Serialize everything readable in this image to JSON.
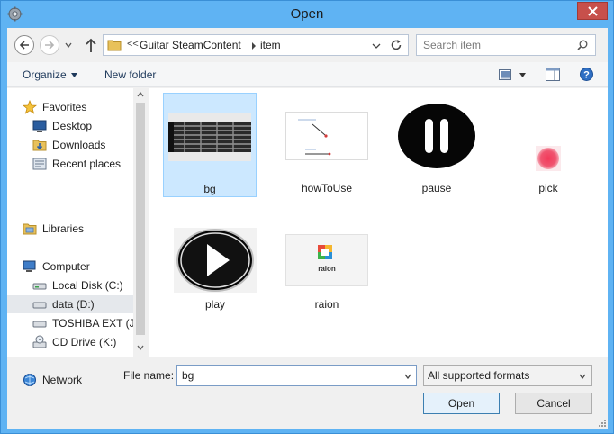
{
  "window": {
    "title": "Open"
  },
  "address_bar": {
    "overflow_chevron": "<<",
    "crumbs": [
      "Guitar SteamContent",
      "item"
    ]
  },
  "search": {
    "placeholder": "Search item"
  },
  "toolbar": {
    "organize_label": "Organize",
    "new_folder_label": "New folder"
  },
  "nav_pane": {
    "items": [
      {
        "label": "Favorites",
        "icon": "star-icon"
      },
      {
        "label": "Desktop",
        "icon": "desktop-icon"
      },
      {
        "label": "Downloads",
        "icon": "downloads-folder-icon"
      },
      {
        "label": "Recent places",
        "icon": "recent-places-icon"
      },
      {
        "label": "Libraries",
        "icon": "libraries-icon"
      },
      {
        "label": "Computer",
        "icon": "computer-icon"
      },
      {
        "label": "Local Disk (C:)",
        "icon": "drive-icon"
      },
      {
        "label": "data (D:)",
        "icon": "drive-icon",
        "selected": true
      },
      {
        "label": "TOSHIBA EXT (J:)",
        "icon": "drive-icon"
      },
      {
        "label": "CD Drive (K:)",
        "icon": "cd-drive-icon"
      },
      {
        "label": "Network",
        "icon": "network-icon"
      }
    ]
  },
  "files": [
    {
      "name": "bg",
      "selected": true
    },
    {
      "name": "howToUse"
    },
    {
      "name": "pause"
    },
    {
      "name": "pick"
    },
    {
      "name": "play"
    },
    {
      "name": "raion"
    }
  ],
  "thumb_text": {
    "raion_logo": "raion"
  },
  "bottom": {
    "file_name_label": "File name:",
    "file_name_value": "bg",
    "filter_value": "All supported formats",
    "open_label": "Open",
    "cancel_label": "Cancel"
  },
  "colors": {
    "title_bar": "#5fb3f3",
    "close_button": "#c7504b",
    "selection": "#cce8ff",
    "link_text": "#1e395b"
  }
}
